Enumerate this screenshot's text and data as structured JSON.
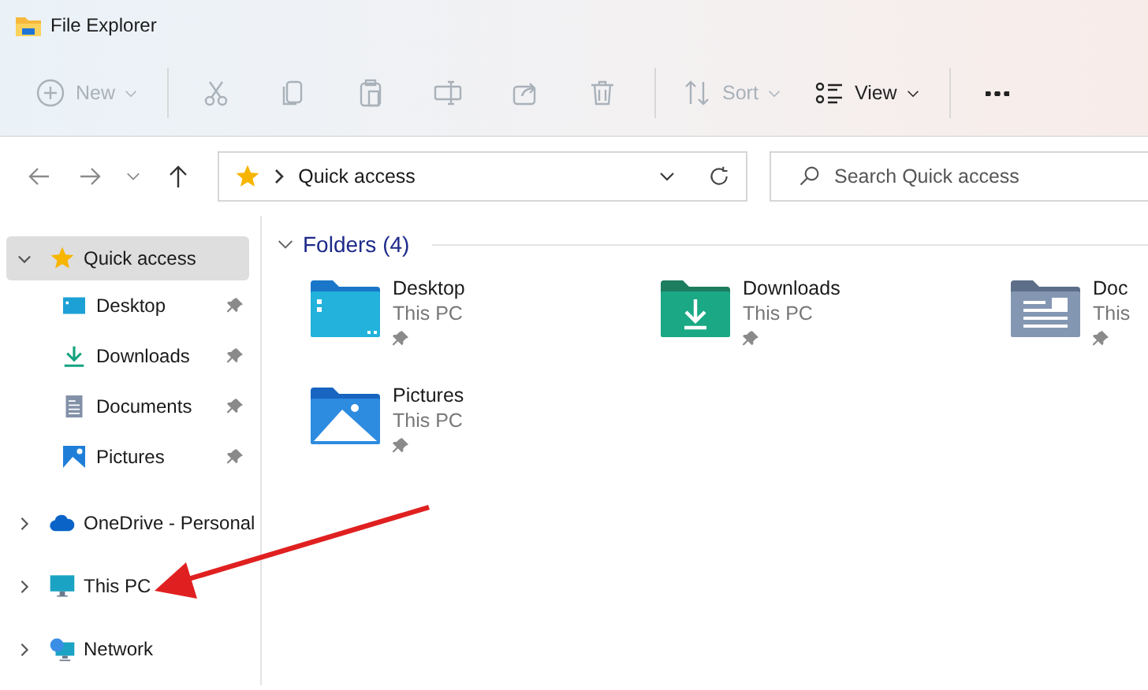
{
  "window": {
    "title": "File Explorer"
  },
  "toolbar": [
    {
      "label": "New",
      "disabled": true,
      "dropdown": true
    },
    {
      "disabled": true
    },
    {
      "disabled": true
    },
    {
      "disabled": true
    },
    {
      "disabled": true
    },
    {
      "disabled": true
    },
    {
      "disabled": true
    },
    {
      "label": "Sort",
      "disabled": true,
      "dropdown": true
    },
    {
      "label": "View",
      "disabled": false,
      "dropdown": true
    },
    {
      "disabled": false
    }
  ],
  "address_bar": {
    "path": "Quick access"
  },
  "search": {
    "placeholder": "Search Quick access"
  },
  "sidebar": {
    "items": [
      {
        "label": "Quick access",
        "expanded": true,
        "selected": true,
        "children": [
          {
            "label": "Desktop",
            "pinned": true
          },
          {
            "label": "Downloads",
            "pinned": true
          },
          {
            "label": "Documents",
            "pinned": true
          },
          {
            "label": "Pictures",
            "pinned": true
          }
        ]
      },
      {
        "label": "OneDrive - Personal",
        "expanded": false,
        "selected": false
      },
      {
        "label": "This PC",
        "expanded": false,
        "selected": false
      },
      {
        "label": "Network",
        "expanded": false,
        "selected": false
      }
    ]
  },
  "content": {
    "group": {
      "title": "Folders (4)",
      "expanded": true
    },
    "folders": [
      {
        "name": "Desktop",
        "location": "This PC",
        "pinned": true
      },
      {
        "name": "Downloads",
        "location": "This PC",
        "pinned": true
      },
      {
        "name": "Doc",
        "location": "This",
        "pinned": true
      },
      {
        "name": "Pictures",
        "location": "This PC",
        "pinned": true
      }
    ]
  }
}
